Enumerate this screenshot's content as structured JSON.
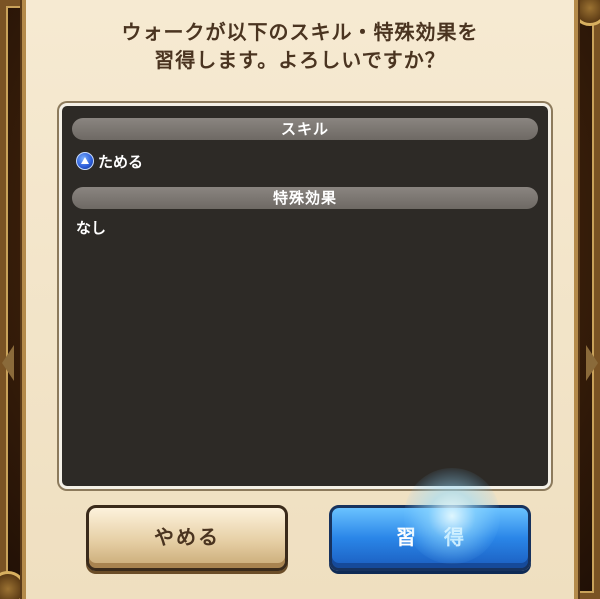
{
  "dialog": {
    "question_line1": "ウォークが以下のスキル・特殊効果を",
    "question_line2": "習得します。よろしいですか？"
  },
  "skills": {
    "header": "スキル",
    "items": [
      {
        "label": "ためる",
        "icon": "skill-orb-icon",
        "icon_color": "#2a5ad8"
      }
    ]
  },
  "effects": {
    "header": "特殊効果",
    "value": "なし"
  },
  "buttons": {
    "cancel_label": "やめる",
    "confirm_label": "習得"
  },
  "colors": {
    "parchment": "#f2e4c8",
    "panel": "#2d2a26",
    "header_pill": "#7a7570",
    "confirm_blue": "#2a86e8"
  }
}
